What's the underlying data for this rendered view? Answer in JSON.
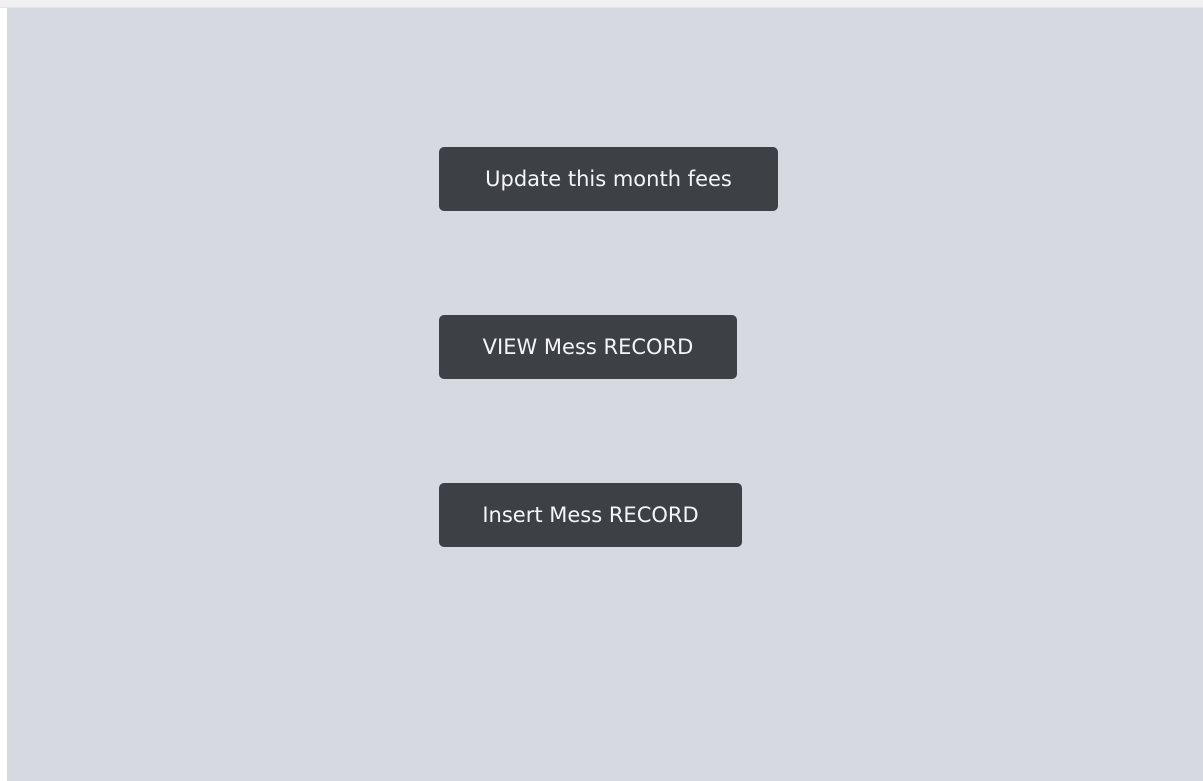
{
  "menu": {
    "buttons": [
      {
        "label": "Update this month fees"
      },
      {
        "label": "VIEW Mess RECORD"
      },
      {
        "label": "Insert Mess RECORD"
      }
    ]
  },
  "colors": {
    "background": "#d6d9e0",
    "button": "#3d4045",
    "button_text": "#f4f5f7"
  }
}
